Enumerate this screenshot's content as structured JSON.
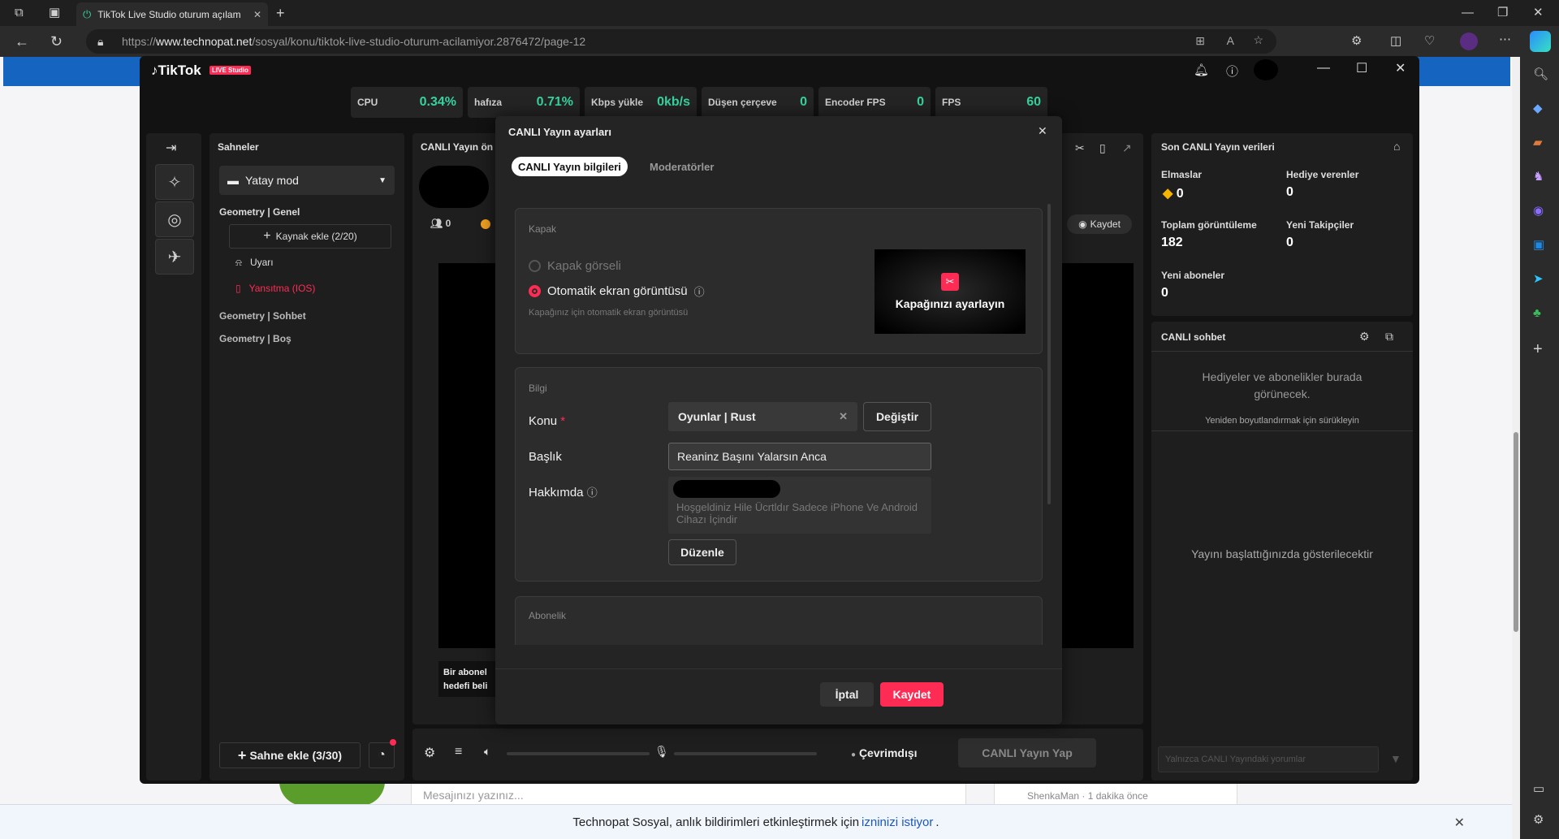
{
  "browser": {
    "tab_title": "TikTok Live Studio oturum açılam",
    "url_scheme": "https://",
    "url_domain": "www.technopat.net",
    "url_path": "/sosyal/konu/tiktok-live-studio-oturum-acilamiyor.2876472/page-12"
  },
  "page": {
    "notify_text": "Technopat Sosyal, anlık bildirimleri etkinleştirmek için",
    "notify_link": "izninizi istiyor",
    "notify_end": ".",
    "message_placeholder": "Mesajınızı yazınız...",
    "side_text": "ShenkaMan · 1 dakika önce"
  },
  "app": {
    "logo": "TikTok",
    "badge": "LIVE Studio"
  },
  "stats": [
    {
      "label": "CPU",
      "value": "0.34%"
    },
    {
      "label": "hafıza",
      "value": "0.71%"
    },
    {
      "label": "Kbps yükle",
      "value": "0kb/s"
    },
    {
      "label": "Düşen çerçeve",
      "value": "0"
    },
    {
      "label": "Encoder FPS",
      "value": "0"
    },
    {
      "label": "FPS",
      "value": "60"
    }
  ],
  "scenes": {
    "title": "Sahneler",
    "mode": "Yatay mod",
    "group1": "Geometry | Genel",
    "add_source": "Kaynak ekle (2/20)",
    "item1": "Uyarı",
    "item2": "Yansıtma (IOS)",
    "group2": "Geometry | Sohbet",
    "group3": "Geometry | Boş",
    "add_scene": "Sahne ekle (3/30)"
  },
  "preview": {
    "title": "CANLI Yayın ön",
    "viewers": "0",
    "record": "Kaydet",
    "goal1": "Bir abonel",
    "goal2": "hedefi beli"
  },
  "bottom": {
    "status": "Çevrimdışı",
    "go_live": "CANLI Yayın Yap"
  },
  "stats_panel": {
    "title": "Son CANLI Yayın verileri",
    "diamonds_label": "Elmaslar",
    "diamonds": "0",
    "gifters_label": "Hediye verenler",
    "gifters": "0",
    "views_label": "Toplam görüntüleme",
    "views": "182",
    "followers_label": "Yeni Takipçiler",
    "followers": "0",
    "subs_label": "Yeni aboneler",
    "subs": "0"
  },
  "chat": {
    "title": "CANLI sohbet",
    "gifts_text": "Hediyeler ve abonelikler burada görünecek.",
    "resize": "Yeniden boyutlandırmak için sürükleyin",
    "empty": "Yayını başlattığınızda gösterilecektir",
    "input_placeholder": "Yalnızca CANLI Yayındaki yorumlar"
  },
  "modal": {
    "title": "CANLI Yayın ayarları",
    "tab1": "CANLI Yayın bilgileri",
    "tab2": "Moderatörler",
    "cover_section": "Kapak",
    "cover_opt1": "Kapak görseli",
    "cover_opt2": "Otomatik ekran görüntüsü",
    "cover_hint": "Kapağınız için otomatik ekran görüntüsü",
    "cover_btn": "Kapağınızı ayarlayın",
    "info_section": "Bilgi",
    "topic_label": "Konu",
    "topic_value": "Oyunlar | Rust",
    "change_btn": "Değiştir",
    "title_label": "Başlık",
    "title_value": "Reaninz Başını Yalarsın Anca",
    "about_label": "Hakkımda",
    "about_text": "Hoşgeldiniz Hile Ücrtldır Sadece iPhone Ve Android Cihazı İçindir",
    "edit_btn": "Düzenle",
    "sub_section": "Abonelik",
    "cancel_btn": "İptal",
    "save_btn": "Kaydet"
  },
  "colors": {
    "accent": "#fe2c55",
    "green": "#36d3a1"
  }
}
